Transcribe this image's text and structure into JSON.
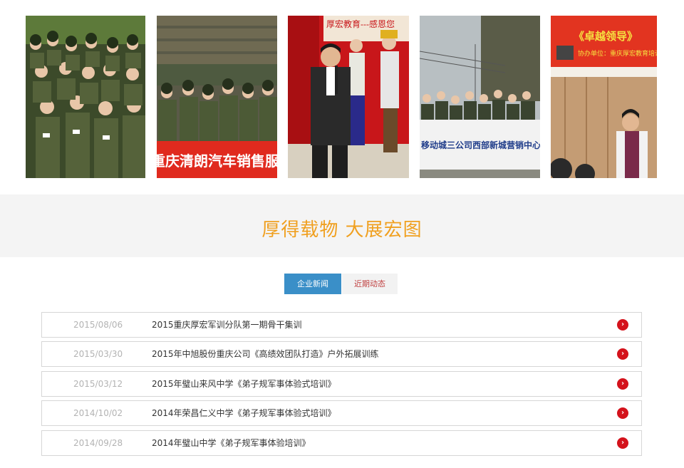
{
  "gallery": {
    "photos": [
      {
        "icon": "training-group-photo"
      },
      {
        "icon": "banner-group-photo",
        "banner_text": "重庆清朗汽车销售服务有限"
      },
      {
        "icon": "speaker-stage-photo",
        "backdrop_text": "厚宏教育---感恩您"
      },
      {
        "icon": "company-banner-photo",
        "banner_text": "移动城三公司西部新城营销中心《高绩效"
      },
      {
        "icon": "lecture-hall-photo",
        "backdrop_text": "《卓越领导》",
        "sub_text": "协办单位：重庆厚宏教育培训"
      }
    ]
  },
  "section": {
    "title": "厚得载物 大展宏图"
  },
  "tabs": [
    {
      "label": "企业新闻",
      "active": true
    },
    {
      "label": "近期动态",
      "active": false
    }
  ],
  "news": [
    {
      "date": "2015/08/06",
      "title": "2015重庆厚宏军训分队第一期骨干集训"
    },
    {
      "date": "2015/03/30",
      "title": "2015年中旭股份重庆公司《高绩效团队打造》户外拓展训练"
    },
    {
      "date": "2015/03/12",
      "title": "2015年璧山来风中学《弟子规军事体验式培训》"
    },
    {
      "date": "2014/10/02",
      "title": "2014年荣昌仁义中学《弟子规军事体验式培训》"
    },
    {
      "date": "2014/09/28",
      "title": "2014年璧山中学《弟子规军事体验培训》"
    }
  ],
  "colors": {
    "accent": "#f0a020",
    "tab_active": "#3a8fc8",
    "arrow": "#d4121b"
  },
  "arrow_glyph": "›"
}
